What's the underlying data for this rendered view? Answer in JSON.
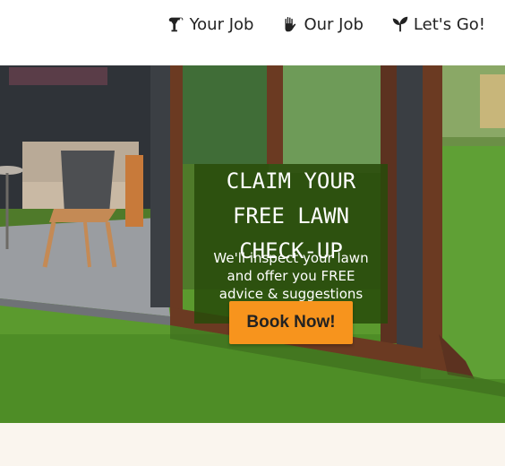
{
  "nav": {
    "items": [
      {
        "label": "Your Job",
        "icon": "watering-can-icon"
      },
      {
        "label": "Our Job",
        "icon": "hand-icon"
      },
      {
        "label": "Let's Go!",
        "icon": "seedling-icon"
      }
    ]
  },
  "hero": {
    "title_lines": [
      "CLAIM YOUR",
      "FREE LAWN",
      "CHECK-UP"
    ],
    "text_lines": [
      "We'll inspect your lawn",
      "and offer you FREE",
      "advice & suggestions"
    ],
    "button_label": "Book Now!",
    "colors": {
      "overlay": "#284b0a",
      "button": "#f7941d",
      "grass": "#5a8a2c"
    }
  },
  "footer": {
    "background": "#faf5ee"
  }
}
